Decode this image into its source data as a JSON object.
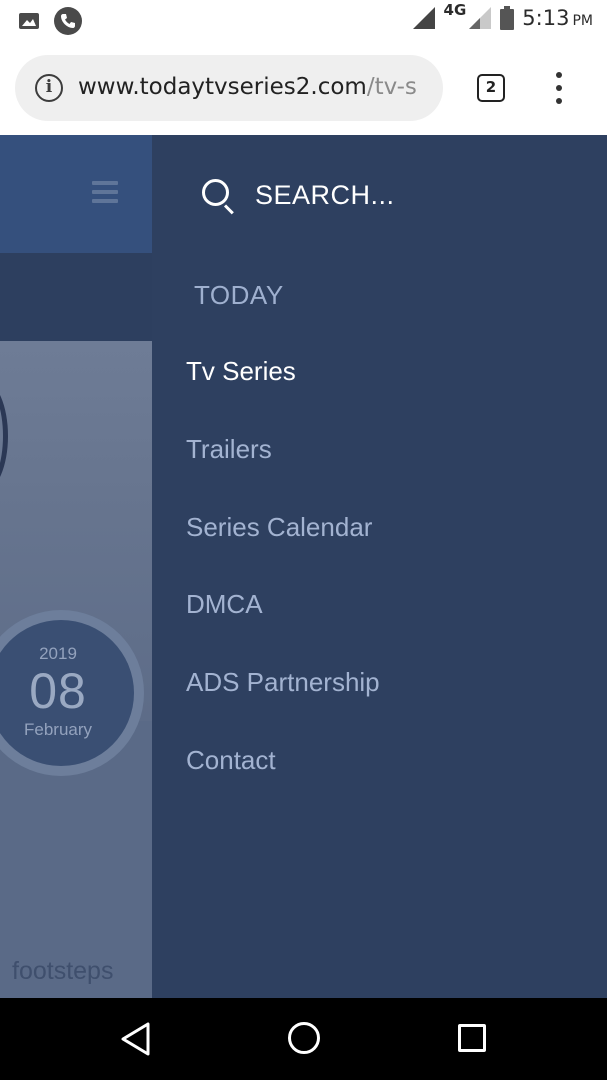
{
  "status_bar": {
    "network": "4G",
    "time": "5:13",
    "ampm": "PM",
    "icons": [
      "image-icon",
      "phone-call-icon",
      "signal-icon",
      "signal-weak-icon",
      "battery-icon"
    ]
  },
  "browser": {
    "url_main": "www.todaytvseries2.com",
    "url_rest": "/tv-s",
    "tab_count": "2"
  },
  "page": {
    "date": {
      "year": "2019",
      "day": "08",
      "month": "February"
    },
    "caption": "footsteps"
  },
  "drawer": {
    "search_label": "SEARCH...",
    "section_title": "TODAY",
    "items": [
      {
        "label": "Tv Series",
        "active": true
      },
      {
        "label": "Trailers"
      },
      {
        "label": "Series Calendar"
      },
      {
        "label": "DMCA"
      },
      {
        "label": "ADS Partnership"
      },
      {
        "label": "Contact"
      }
    ]
  },
  "colors": {
    "drawer_bg": "#2e4060",
    "header_bg": "#35507d",
    "active_text": "#ffffff",
    "inactive_text": "#a3b3d1"
  }
}
